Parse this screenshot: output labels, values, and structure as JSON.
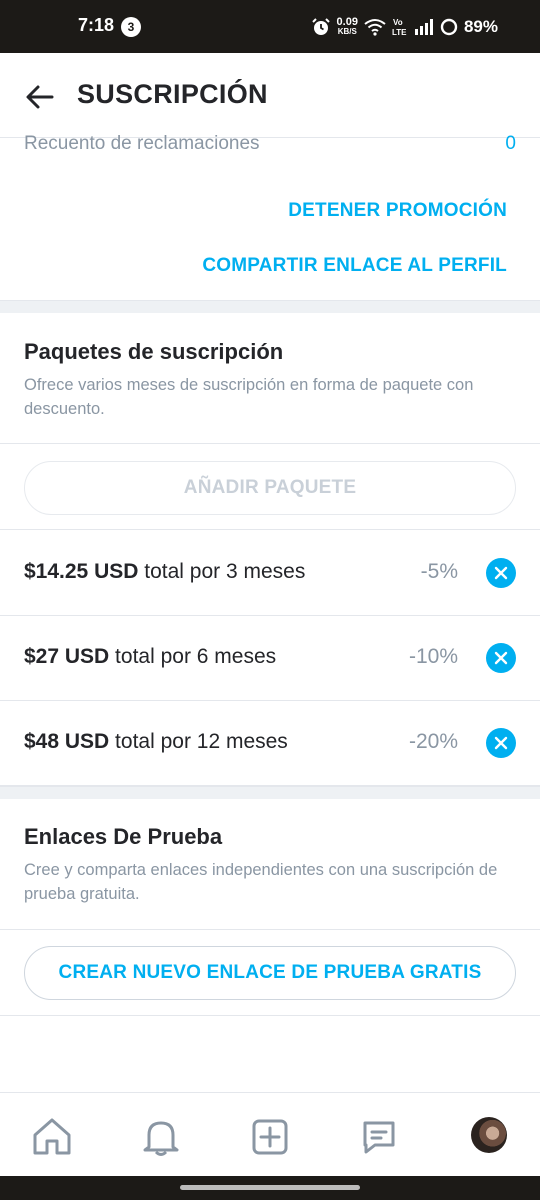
{
  "status_bar": {
    "time": "7:18",
    "notification_count": "3",
    "speed_value": "0.09",
    "speed_unit": "KB/S",
    "network": "Vo LTE",
    "battery": "89%"
  },
  "header": {
    "title": "SUSCRIPCIÓN"
  },
  "promotion": {
    "claims_label": "Recuento de reclamaciones",
    "claims_value": "0",
    "stop_label": "DETENER PROMOCIÓN",
    "share_label": "COMPARTIR ENLACE AL PERFIL"
  },
  "bundles": {
    "title": "Paquetes de suscripción",
    "description": "Ofrece varios meses de suscripción en forma de paquete con descuento.",
    "add_label": "AÑADIR PAQUETE",
    "items": [
      {
        "price": "$14.25 USD",
        "text": " total por 3 meses",
        "discount": "-5%"
      },
      {
        "price": "$27 USD",
        "text": " total por 6 meses",
        "discount": "-10%"
      },
      {
        "price": "$48 USD",
        "text": " total por 12 meses",
        "discount": "-20%"
      }
    ]
  },
  "trial": {
    "title": "Enlaces De Prueba",
    "description": "Cree y comparta enlaces independientes con una suscripción de prueba gratuita.",
    "create_label": "CREAR NUEVO ENLACE DE PRUEBA GRATIS"
  },
  "nav": {
    "items": [
      "home-icon",
      "bell-icon",
      "plus-square-icon",
      "chat-icon",
      "avatar"
    ]
  },
  "colors": {
    "accent": "#00aff0",
    "muted_text": "#8a96a3",
    "status_bar": "#1c1a17"
  }
}
